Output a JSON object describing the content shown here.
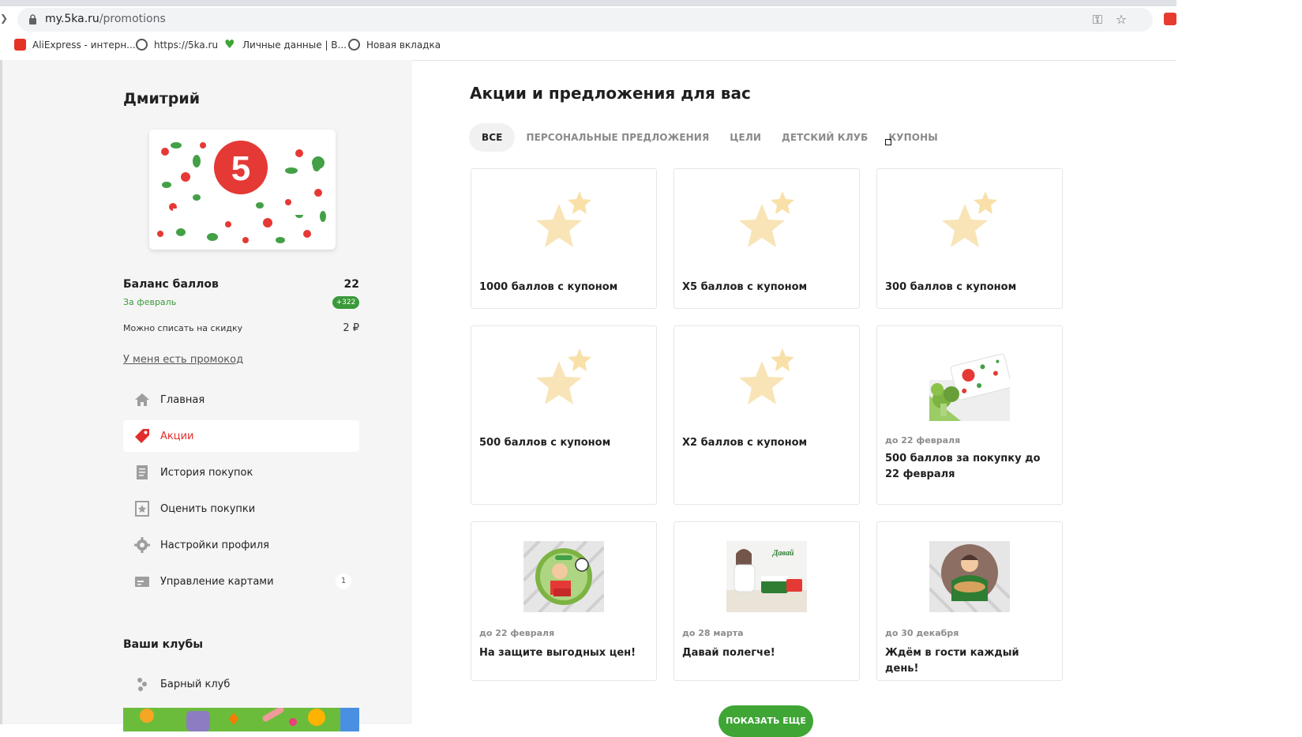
{
  "browser": {
    "url_host": "my.5ka.ru",
    "url_path": "/promotions",
    "bookmarks": [
      {
        "label": "AliExpress - интерн...",
        "icon": "aliexpress-icon"
      },
      {
        "label": "https://5ka.ru",
        "icon": "globe-icon"
      },
      {
        "label": "Личные данные | В...",
        "icon": "heart-icon"
      },
      {
        "label": "Новая вкладка",
        "icon": "globe-icon"
      }
    ]
  },
  "sidebar": {
    "user_name": "Дмитрий",
    "balance_title": "Баланс баллов",
    "balance_value": "22",
    "balance_period": "За февраль",
    "balance_delta": "+322",
    "writeoff_label": "Можно списать на скидку",
    "writeoff_value": "2 ₽",
    "promo_link": "У меня есть промокод",
    "nav": [
      {
        "label": "Главная",
        "icon": "home-icon"
      },
      {
        "label": "Акции",
        "icon": "tag-icon",
        "active": true
      },
      {
        "label": "История покупок",
        "icon": "receipt-icon"
      },
      {
        "label": "Оценить покупки",
        "icon": "rate-star-icon"
      },
      {
        "label": "Настройки профиля",
        "icon": "gear-icon"
      },
      {
        "label": "Управление картами",
        "icon": "card-icon",
        "count": "1"
      }
    ],
    "clubs_title": "Ваши клубы",
    "club_item": "Барный клуб"
  },
  "main": {
    "title": "Акции и предложения для вас",
    "tabs": [
      "ВСЕ",
      "ПЕРСОНАЛЬНЫЕ ПРЕДЛОЖЕНИЯ",
      "ЦЕЛИ",
      "ДЕТСКИЙ КЛУБ",
      "КУПОНЫ"
    ],
    "tiles": [
      {
        "title": "1000 баллов с купоном",
        "date": "",
        "art": "star"
      },
      {
        "title": "X5 баллов с купоном",
        "date": "",
        "art": "star"
      },
      {
        "title": "300 баллов с купоном",
        "date": "",
        "art": "star"
      },
      {
        "title": "500 баллов с купоном",
        "date": "",
        "art": "star"
      },
      {
        "title": "X2 баллов с купоном",
        "date": "",
        "art": "star"
      },
      {
        "title": "500 баллов за покупку до 22 февраля",
        "date": "до 22 февраля",
        "art": "card-broccoli"
      },
      {
        "title": "На защите выгодных цен!",
        "date": "до 22 февраля",
        "art": "hero-badge"
      },
      {
        "title": "Давай полегче!",
        "date": "до 28 марта",
        "art": "woman-yogurt"
      },
      {
        "title": "Ждём в гости каждый день!",
        "date": "до 30 декабря",
        "art": "baker"
      }
    ],
    "more_button": "ПОКАЗАТЬ ЕЩЕ"
  },
  "colors": {
    "accent_red": "#e22d2d",
    "accent_green": "#3fa535",
    "sidebar_bg": "#f5f5f5"
  }
}
